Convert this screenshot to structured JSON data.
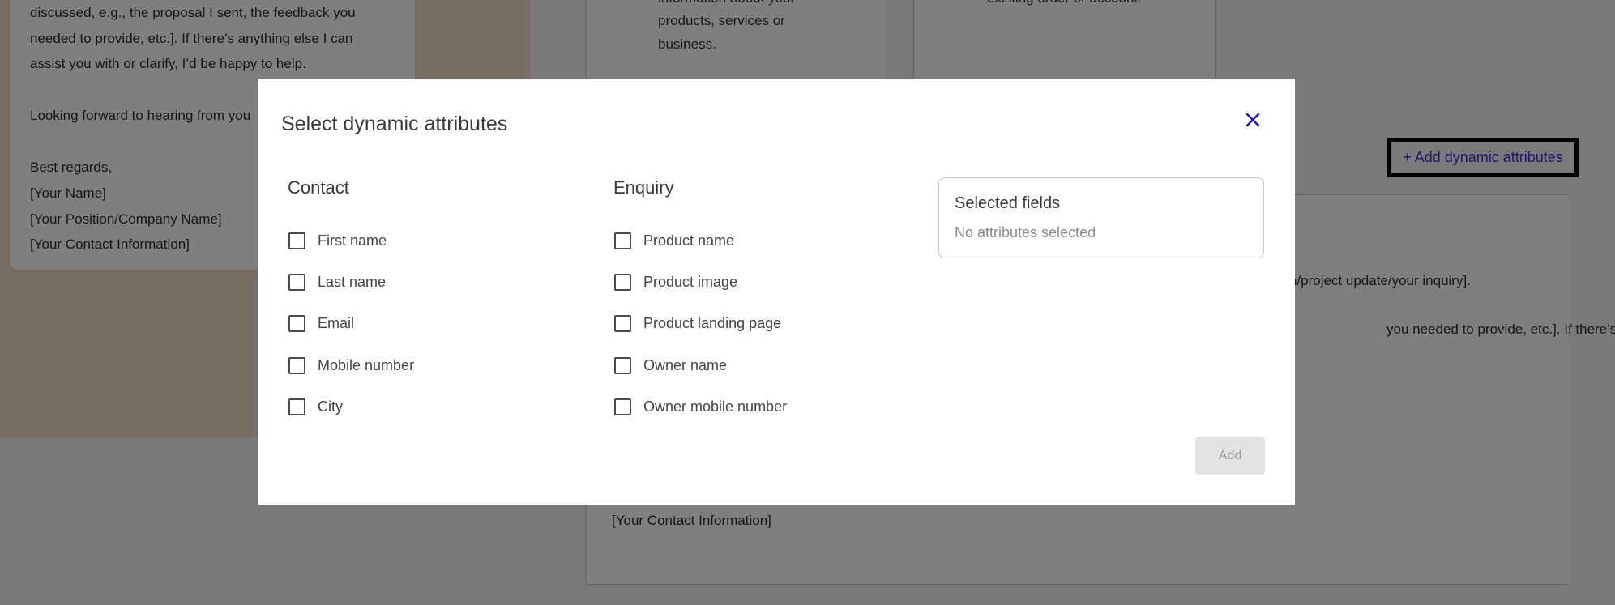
{
  "background": {
    "email_preview": {
      "lines": [
        "discussed, e.g., the proposal I sent, the feedback you",
        "needed to provide, etc.]. If there’s anything else I can",
        "assist you with or clarify, I’d be happy to help.",
        "",
        "Looking forward to hearing from you",
        "",
        "Best regards,",
        "[Your Name]",
        "[Your Position/Company Name]",
        "[Your Contact Information]"
      ]
    },
    "card_middle": {
      "lines": [
        "information about your",
        "products, services or",
        "business."
      ]
    },
    "card_right": {
      "lines": [
        "existing order or account."
      ]
    },
    "add_dynamic_attributes_label": "+ Add dynamic attributes",
    "editor": {
      "line_1": "tion/project update/your inquiry].",
      "line_2": "you needed to provide, etc.]. If there’s",
      "line_3": "[Your Contact Information]"
    }
  },
  "modal": {
    "title": "Select dynamic attributes",
    "close_icon": "close-icon",
    "contact": {
      "title": "Contact",
      "options": [
        "First name",
        "Last name",
        "Email",
        "Mobile number",
        "City"
      ]
    },
    "enquiry": {
      "title": "Enquiry",
      "options": [
        "Product name",
        "Product image",
        "Product landing page",
        "Owner name",
        "Owner mobile number"
      ]
    },
    "selected": {
      "title": "Selected fields",
      "empty_text": "No attributes selected"
    },
    "add_label": "Add"
  },
  "colors": {
    "accent": "#3a2fd6",
    "close_icon": "#1a12c9",
    "overlay": "rgba(0,0,0,0.5)"
  }
}
